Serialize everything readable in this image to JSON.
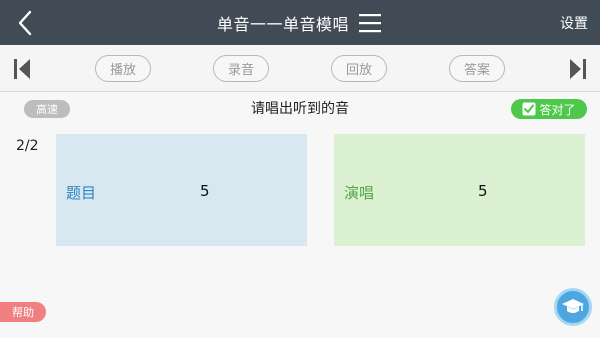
{
  "header": {
    "title": "单音一一单音模唱",
    "settings_label": "设置",
    "background_color": "#404b56",
    "back_icon": "chevron-left-icon",
    "menu_icon": "hamburger-menu-icon"
  },
  "toolbar": {
    "first_icon": "skip-to-first-icon",
    "last_icon": "skip-to-last-icon",
    "buttons": [
      {
        "label": "播放"
      },
      {
        "label": "录音"
      },
      {
        "label": "回放"
      },
      {
        "label": "答案"
      }
    ]
  },
  "instruction_row": {
    "speed_label": "高速",
    "instruction": "请唱出听到的音",
    "correct_label": "答对了",
    "correct_color": "#4ec84a"
  },
  "progress": "2/2",
  "panels": {
    "question": {
      "label": "题目",
      "value": "5",
      "color": "#d7e8f1"
    },
    "sing": {
      "label": "演唱",
      "value": "5",
      "color": "#dcf1d2"
    }
  },
  "bottom": {
    "help_label": "帮助",
    "cap_icon": "graduation-cap-icon"
  }
}
